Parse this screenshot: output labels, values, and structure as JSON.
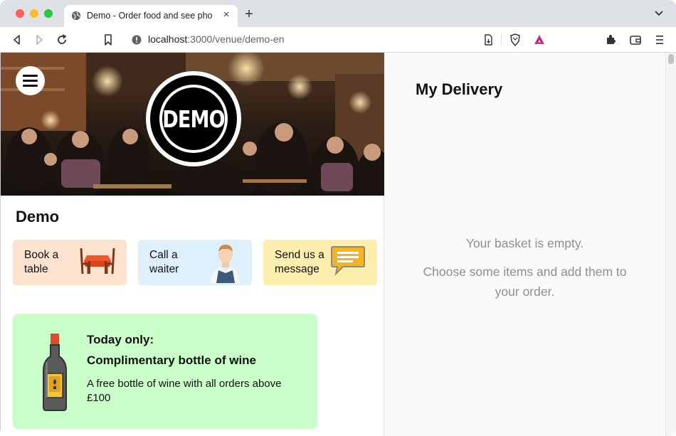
{
  "browser": {
    "tab_title": "Demo - Order food and see pho",
    "tab_close": "×",
    "new_tab": "+",
    "url_host": "localhost",
    "url_path": ":3000/venue/demo-en"
  },
  "hero": {
    "logo_text": "DEMO"
  },
  "venue": {
    "title": "Demo"
  },
  "actions": [
    {
      "label": "Book a table",
      "color": "#fde2d0"
    },
    {
      "label": "Call a waiter",
      "color": "#ddf0fc"
    },
    {
      "label": "Send us a message",
      "color": "#fdeeae"
    }
  ],
  "promo": {
    "line1": "Today only:",
    "line2": "Complimentary bottle of wine",
    "description": "A free bottle of wine with all orders above £100",
    "color": "#caffca"
  },
  "basket": {
    "title": "My Delivery",
    "empty": "Your basket is empty.",
    "hint": "Choose some items and add them to your order."
  }
}
